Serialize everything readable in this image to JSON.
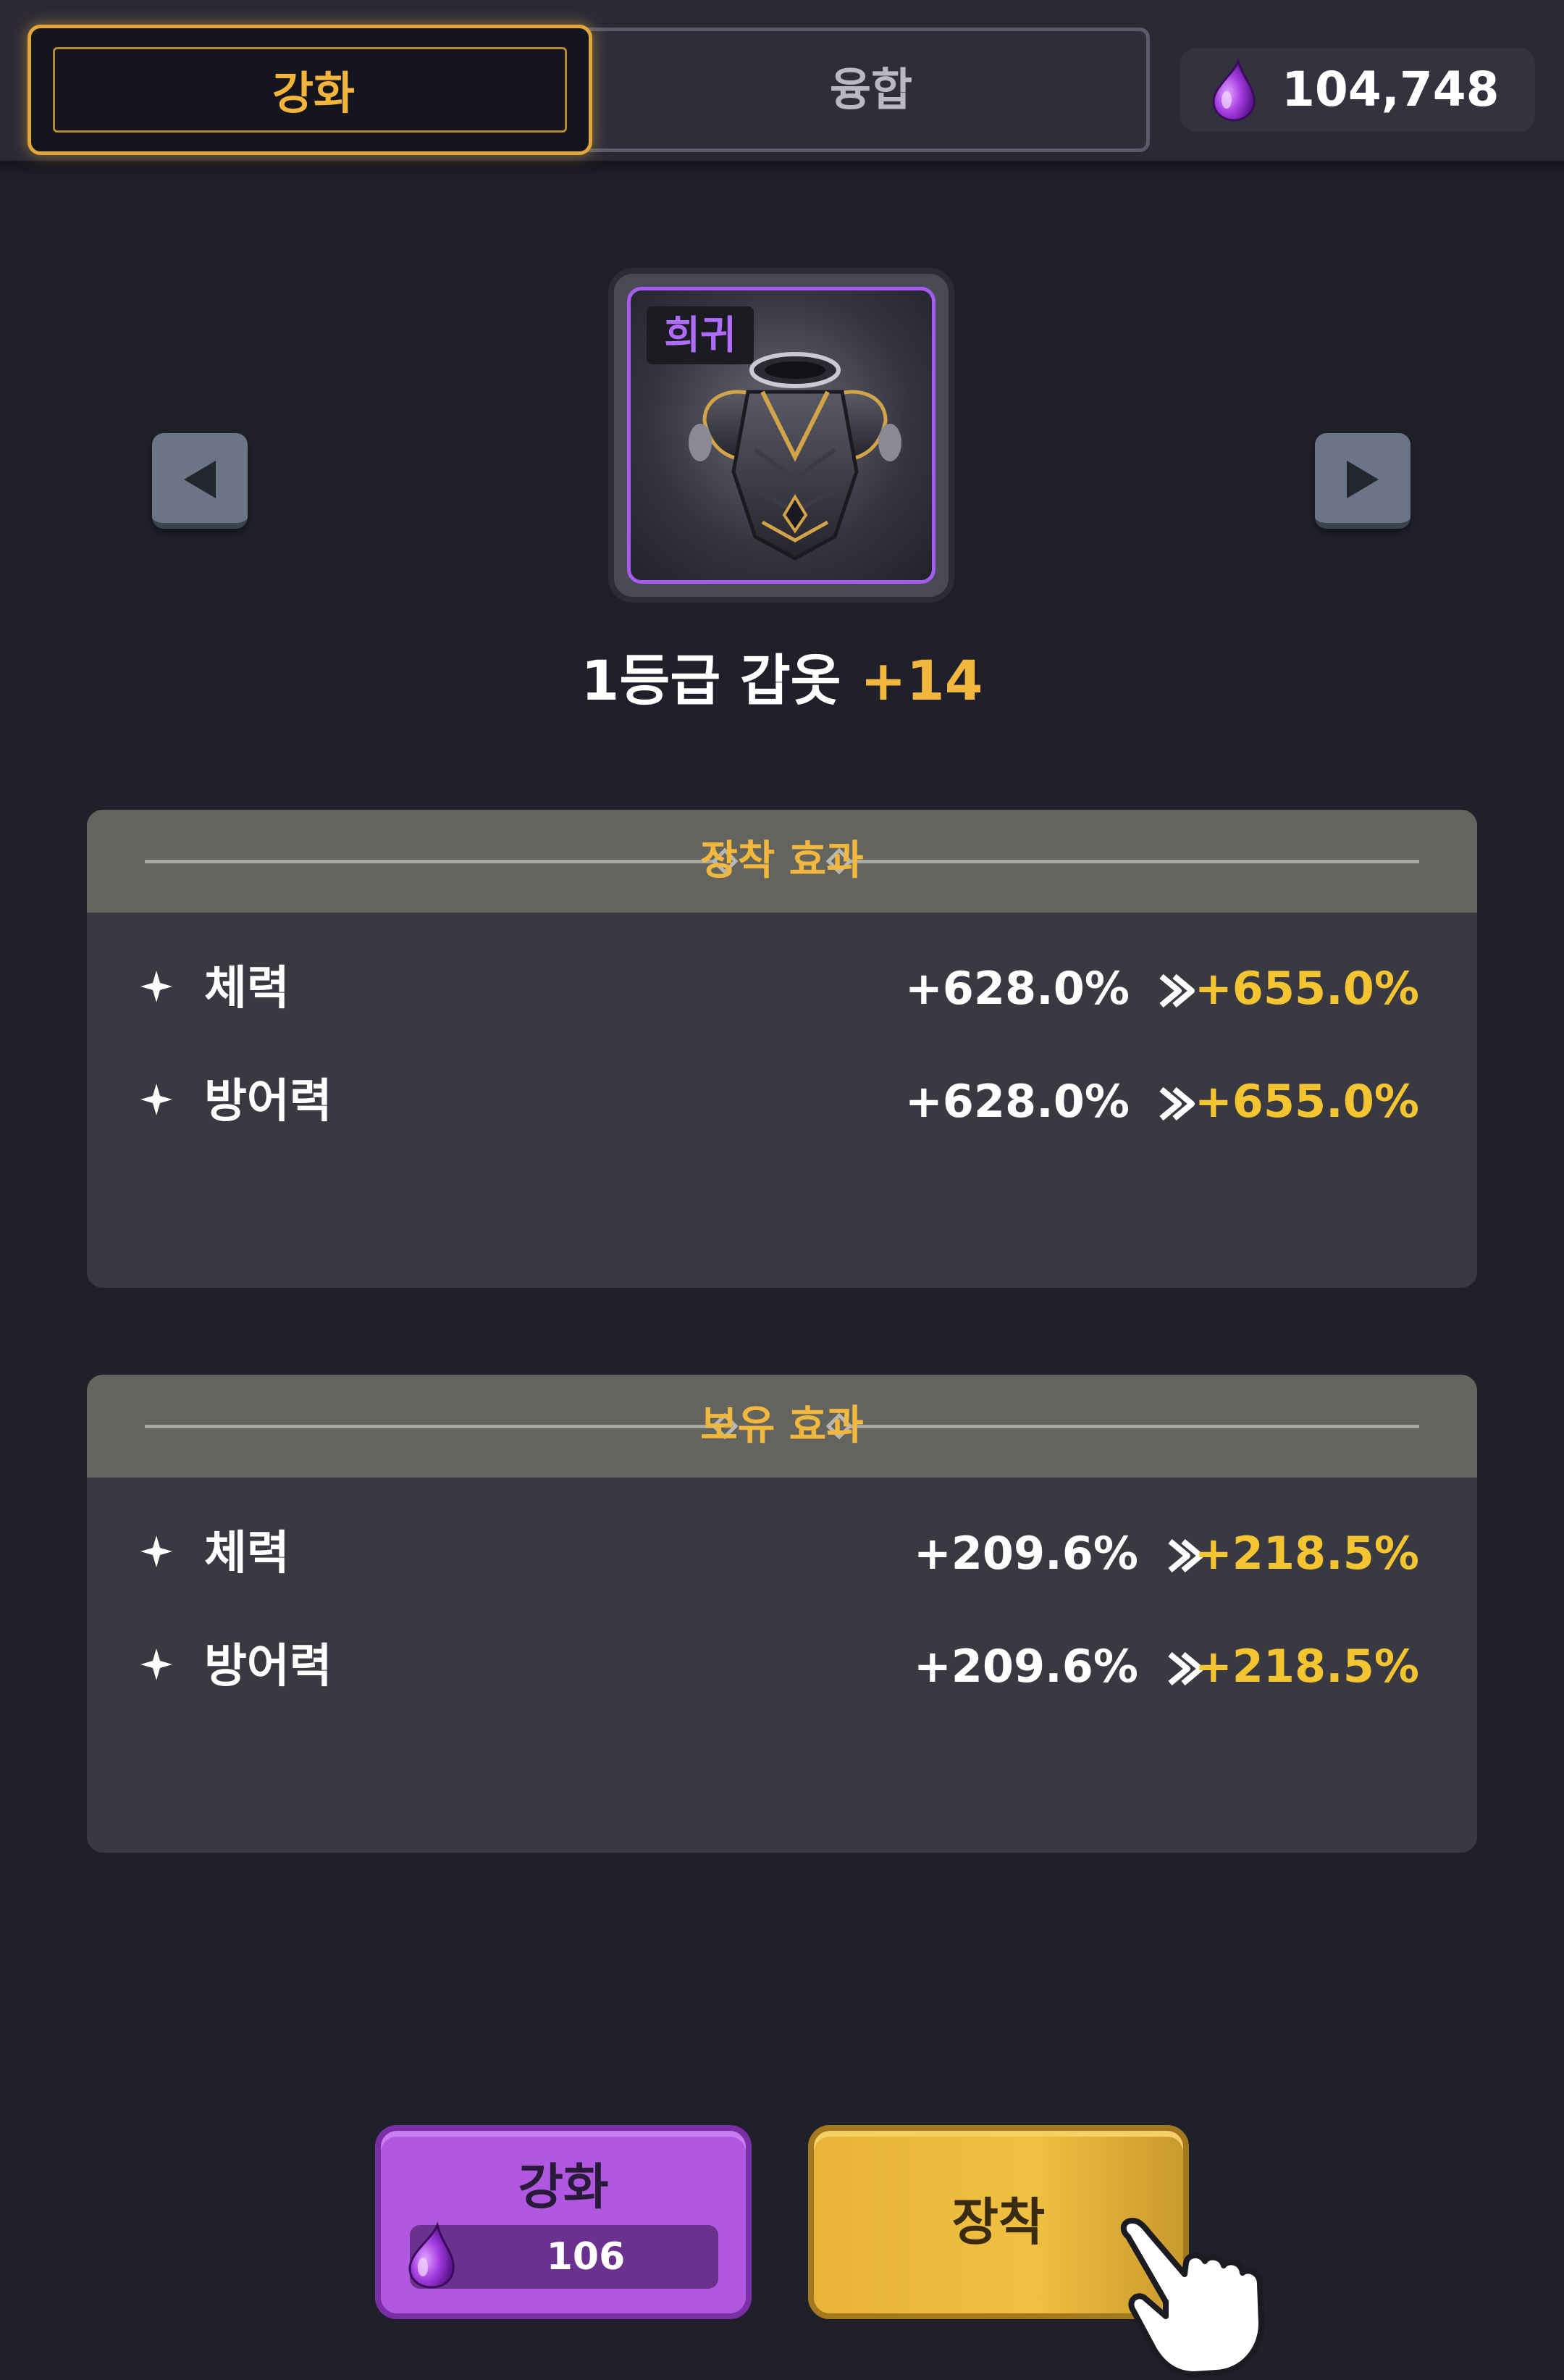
{
  "tabs": {
    "upgrade_label": "강화",
    "fusion_label": "융합"
  },
  "currency": {
    "icon": "purple-drop-icon",
    "amount": "104,748"
  },
  "item": {
    "rarity": "희귀",
    "name": "1등급 갑옷",
    "level": "+14",
    "art": "dark-armor-chestplate"
  },
  "equip_effect": {
    "title": "장착 효과",
    "stats": [
      {
        "name": "체력",
        "current": "+628.0%",
        "next": "+655.0%"
      },
      {
        "name": "방어력",
        "current": "+628.0%",
        "next": "+655.0%"
      }
    ]
  },
  "owned_effect": {
    "title": "보유 효과",
    "stats": [
      {
        "name": "체력",
        "current": "+209.6%",
        "next": "+218.5%"
      },
      {
        "name": "방어력",
        "current": "+209.6%",
        "next": "+218.5%"
      }
    ]
  },
  "buttons": {
    "upgrade_label": "강화",
    "upgrade_cost": "106",
    "equip_label": "장착"
  },
  "colors": {
    "background": "#20202b",
    "accent_gold": "#f2b83e",
    "rarity_purple": "#a45cf2",
    "upgrade_button": "#b058e0",
    "equip_button": "#f0c040"
  }
}
